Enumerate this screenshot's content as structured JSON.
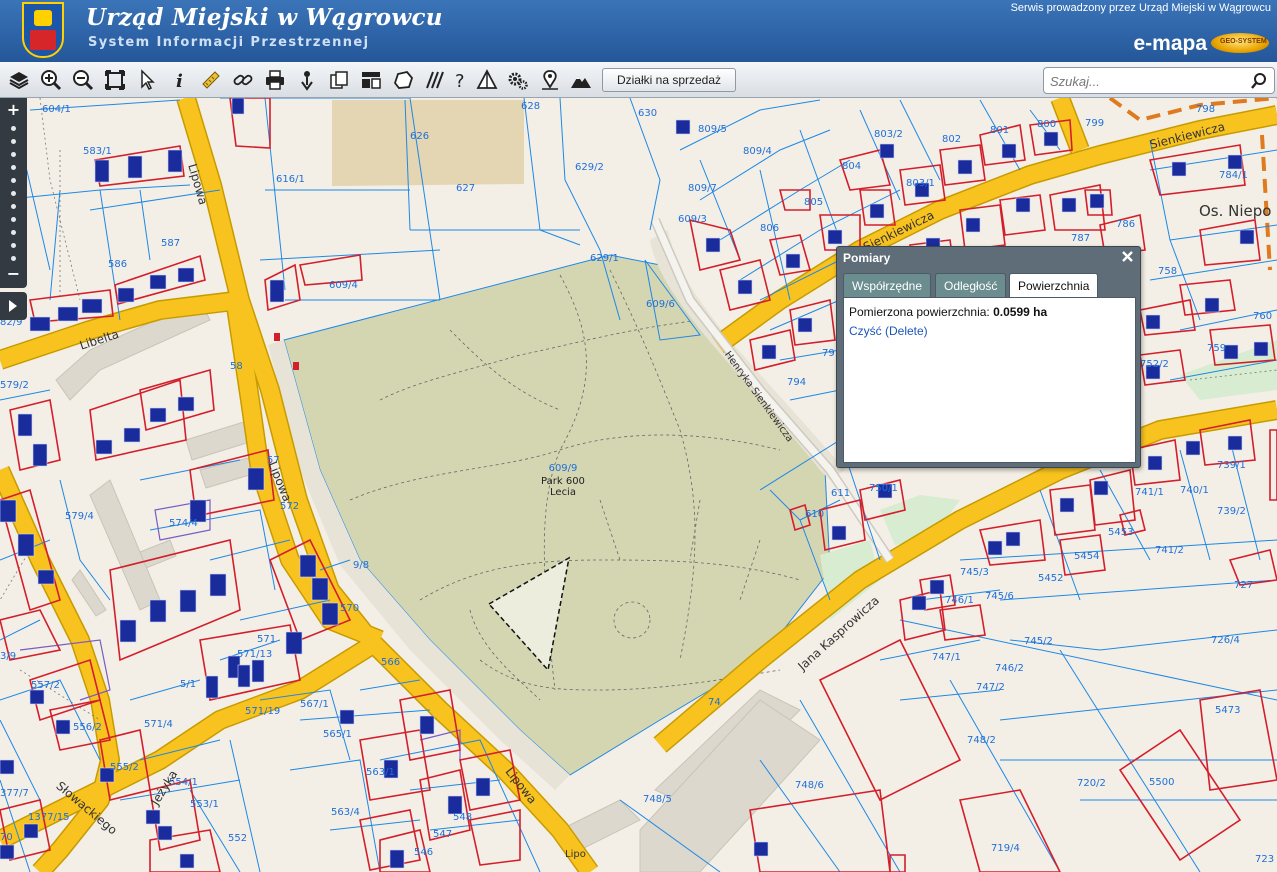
{
  "header": {
    "title": "Urząd Miejski w Wągrowcu",
    "subtitle": "System Informacji Przestrzennej",
    "service_note": "Serwis prowadzony przez Urząd Miejski w Wągrowcu",
    "brand": "e-mapa",
    "brand_badge": "GEO-SYSTEM"
  },
  "toolbar": {
    "tools": [
      "layers-icon",
      "zoom-in-icon",
      "zoom-out-icon",
      "full-extent-icon",
      "select-pointer-icon",
      "info-icon",
      "ruler-icon",
      "link-icon",
      "print-icon",
      "pan-marker-icon",
      "extract-icon",
      "layout-icon",
      "shape-icon",
      "hatch-icon",
      "help-icon",
      "triangle-measure-icon",
      "settings-icon",
      "place-marker-icon",
      "terrain-icon"
    ],
    "sale_button": "Działki na sprzedaż",
    "search_placeholder": "Szukaj..."
  },
  "dialog": {
    "title": "Pomiary",
    "tabs": [
      "Współrzędne",
      "Odległość",
      "Powierzchnia"
    ],
    "active_tab": "Powierzchnia",
    "result_label": "Pomierzona powierzchnia:",
    "result_value": "0.0599 ha",
    "clear_link": "Czyść (Delete)"
  },
  "map": {
    "park_parcel": "609/9",
    "park_name_1": "Park 600",
    "park_name_2": "Lecia",
    "streets": {
      "lipowa_1": "Lipowa",
      "lipowa_2": "Lipowa",
      "lipowa_3": "Lipowa",
      "libelta": "Libelta",
      "sienkiewicza_1": "Sienkiewicza",
      "sienkiewicza_2": "Sienkiewicza",
      "henryka": "Henryka Sienkiewicza",
      "kasprowicza": "Jana Kasprowicza",
      "jezyka": "Jeżyka",
      "slowackiego": "Słowackiego",
      "lipo": "Lipo"
    },
    "district": "Os. Niepo",
    "parcels": {
      "p604_1": "604/1",
      "p628": "628",
      "p626": "626",
      "p630": "630",
      "p616_1": "616/1",
      "p627": "627",
      "p583_1": "583/1",
      "p629_2": "629/2",
      "p809_5": "809/5",
      "p809_4": "809/4",
      "p809_7": "809/7",
      "p803_2": "803/2",
      "p802": "802",
      "p801": "801",
      "p800": "800",
      "p799": "799",
      "p798": "798",
      "p804": "804",
      "p803_1": "803/1",
      "p805": "805",
      "p609_3": "609/3",
      "p806": "806",
      "p587": "587",
      "p586": "586",
      "p609_4": "609/4",
      "p629_1": "629/1",
      "p609_6": "609/6",
      "p787": "787",
      "p786": "786",
      "p784_1": "784/1",
      "p758": "758",
      "p760": "760",
      "p759": "759",
      "p752_2": "752/2",
      "p794": "794",
      "p79": "79",
      "p58": "58",
      "p579_2": "579/2",
      "p57": "57",
      "p572": "572",
      "p579_4": "579/4",
      "p574_4": "574/4",
      "p611": "611",
      "p610": "610",
      "p750_1": "750/1",
      "p739_1": "739/1",
      "p741_1": "741/1",
      "p740_1": "740/1",
      "p739_2": "739/2",
      "p5453": "5453",
      "p5454": "5454",
      "p741_2": "741/2",
      "p745_3": "745/3",
      "p5452": "5452",
      "p727": "727",
      "p746_1": "746/1",
      "p745_6": "745/6",
      "p726_4": "726/4",
      "p745_2": "745/2",
      "p747_1": "747/1",
      "p746_2": "746/2",
      "p747_2": "747/2",
      "p5473": "5473",
      "p748_2": "748/2",
      "p720_2": "720/2",
      "p5500": "5500",
      "p748_5": "748/5",
      "p748_6": "748/6",
      "p719_4": "719/4",
      "p723": "723",
      "p571": "571",
      "p571_13": "571/13",
      "p570": "570",
      "p9_8": "9/8",
      "p566": "566",
      "p567_1": "567/1",
      "p565_1": "565/1",
      "p571_19": "571/19",
      "p557_2": "557/2",
      "p556_2": "556/2",
      "p571_4": "571/4",
      "p555_2": "555/2",
      "p554_1": "554/1",
      "p553_1": "553/1",
      "p563_1": "563/1",
      "p563_4": "563/4",
      "p548": "548",
      "p547": "547",
      "p546": "546",
      "p552": "552",
      "p1377_15": "1377/15",
      "p377_7": "377/7",
      "p82_9": "82/9",
      "p3_9": "3/9",
      "p70": "70",
      "p74": "74",
      "p5_1": "5/1"
    }
  }
}
